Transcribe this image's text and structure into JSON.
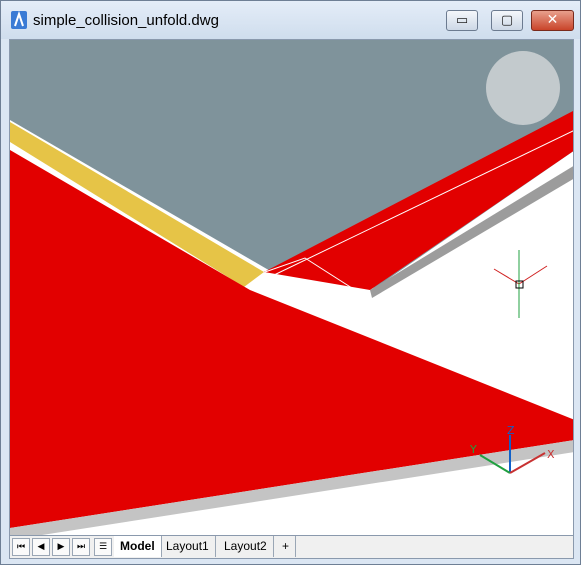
{
  "window": {
    "title": "simple_collision_unfold.dwg",
    "minimize_glyph": "▭",
    "maximize_glyph": "▢",
    "close_glyph": "✕"
  },
  "colors": {
    "face_red": "#e20000",
    "face_gray": "#7f939b",
    "edge_yellow": "#e6c447",
    "edge_gray": "#9c9c9c",
    "background": "#ffffff"
  },
  "navigation_wheel": {
    "icon": "nav-wheel-icon"
  },
  "ucs_icon": {
    "z_label": "Z",
    "x_label": "X",
    "y_label": "Y"
  },
  "layout_tabs": {
    "nav_first": "⏮",
    "nav_prev": "◀",
    "nav_next": "▶",
    "nav_last": "⏭",
    "tabs": [
      "Model",
      "Layout1",
      "Layout2"
    ],
    "add_label": "+"
  }
}
